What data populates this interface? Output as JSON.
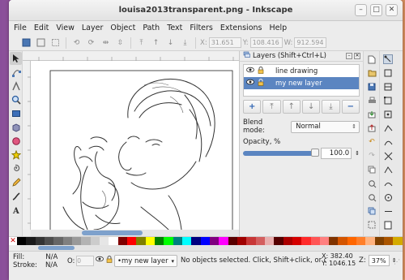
{
  "window": {
    "title": "louisa2013transparent.png - Inkscape",
    "buttons": [
      "–",
      "□",
      "✕"
    ]
  },
  "menu": [
    "File",
    "Edit",
    "View",
    "Layer",
    "Object",
    "Path",
    "Text",
    "Filters",
    "Extensions",
    "Help"
  ],
  "toolbar": {
    "x_label": "X:",
    "x_value": "31.651",
    "y_label": "Y:",
    "y_value": "108.416",
    "w_label": "W:",
    "w_value": "912.594"
  },
  "tools": [
    "selector-icon",
    "node-icon",
    "tweak-icon",
    "zoom-icon",
    "rectangle-icon",
    "3d-box-icon",
    "ellipse-icon",
    "star-icon",
    "spiral-icon",
    "pencil-icon",
    "text-icon"
  ],
  "layers_panel": {
    "title": "Layers (Shift+Ctrl+L)",
    "layers": [
      {
        "name": "line drawing",
        "selected": false
      },
      {
        "name": "my new layer",
        "selected": true
      }
    ],
    "blend_label": "Blend mode:",
    "blend_value": "Normal",
    "opacity_label": "Opacity, %",
    "opacity_value": "100.0",
    "opacity_fraction": 1.0
  },
  "palette_colors": [
    "#000000",
    "#1a1a1a",
    "#333333",
    "#4d4d4d",
    "#666666",
    "#808080",
    "#999999",
    "#b3b3b3",
    "#cccccc",
    "#e6e6e6",
    "#ffffff",
    "#800000",
    "#ff0000",
    "#808000",
    "#ffff00",
    "#008000",
    "#00ff00",
    "#008080",
    "#00ffff",
    "#000080",
    "#0000ff",
    "#800080",
    "#ff00ff",
    "#5a0000",
    "#a00000",
    "#c83737",
    "#d35f5f",
    "#e9afaf",
    "#550000",
    "#aa0000",
    "#d40000",
    "#ff2a2a",
    "#ff5555",
    "#ff8080",
    "#803300",
    "#d45500",
    "#ff6600",
    "#ff7f2a",
    "#ffb380",
    "#804000",
    "#aa5500",
    "#d4aa00"
  ],
  "status": {
    "fill_label": "Fill:",
    "fill_value": "N/A",
    "stroke_label": "Stroke:",
    "stroke_value": "N/A",
    "o_label": "O:",
    "o_value": "0",
    "layer": "•my new layer",
    "message": "No objects selected. Click, Shift+click, or dr",
    "x_label": "X:",
    "x_value": "382.40",
    "y_label": "Y:",
    "y_value": "1046.15",
    "z_label": "Z:",
    "zoom_value": "37%"
  }
}
